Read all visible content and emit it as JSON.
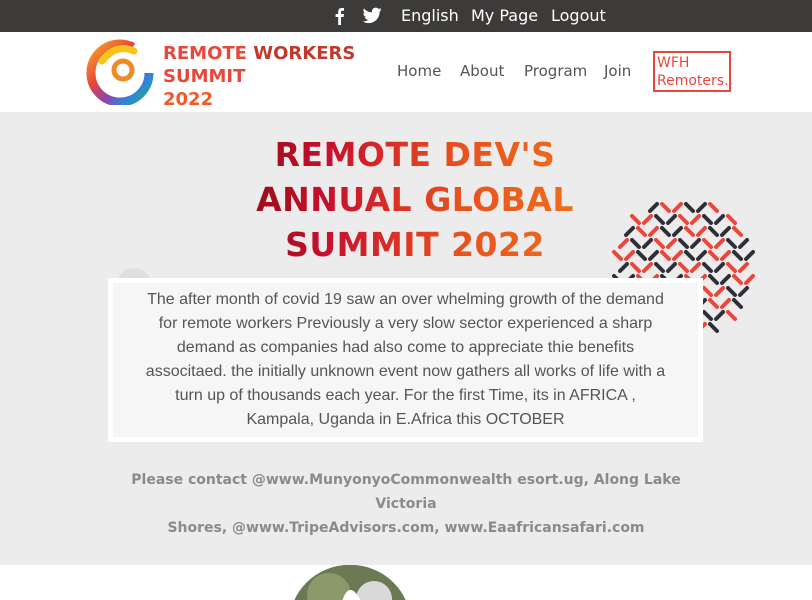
{
  "topbar": {
    "icons": [
      "facebook-icon",
      "twitter-icon"
    ],
    "links": [
      "English",
      "My Page",
      "Logout"
    ]
  },
  "header": {
    "brand": {
      "line1a": "REMOTE",
      "line1b": "WORKERS",
      "line2": "SUMMIT",
      "line3": "2022"
    },
    "nav": [
      "Home",
      "About",
      "Program",
      "Join"
    ],
    "cta": {
      "line1": "WFH",
      "line2": "Remoters.."
    }
  },
  "hero": {
    "title_lines": [
      "REMOTE DEV'S",
      "ANNUAL GLOBAL",
      "SUMMIT 2022"
    ],
    "description": [
      "The after month of covid 19 saw an over whelming growth of the demand",
      "for remote workers Previously a very slow sector experienced a sharp",
      "demand as companies had also come to appreciate thie benefits",
      "associtaed. the initially unknown event now gathers all works of life with a",
      "turn up of thousands each year. For the first Time, its in AFRICA ,",
      "Kampala, Uganda in E.Africa this OCTOBER"
    ],
    "contact_lines": [
      "Please contact @www.MunyonyoCommonwealth esort.ug, Along Lake Victoria",
      "Shores, @www.TripeAdvisors.com, www.Eaafricansafari.com"
    ]
  },
  "colors": {
    "topbar_bg": "#3d3b39",
    "brand_red": "#e8473b",
    "brand_orange": "#f05a28",
    "hero_bg": "#ececec",
    "dot_red": "#e8473b",
    "dot_dark": "#2f2f38"
  }
}
